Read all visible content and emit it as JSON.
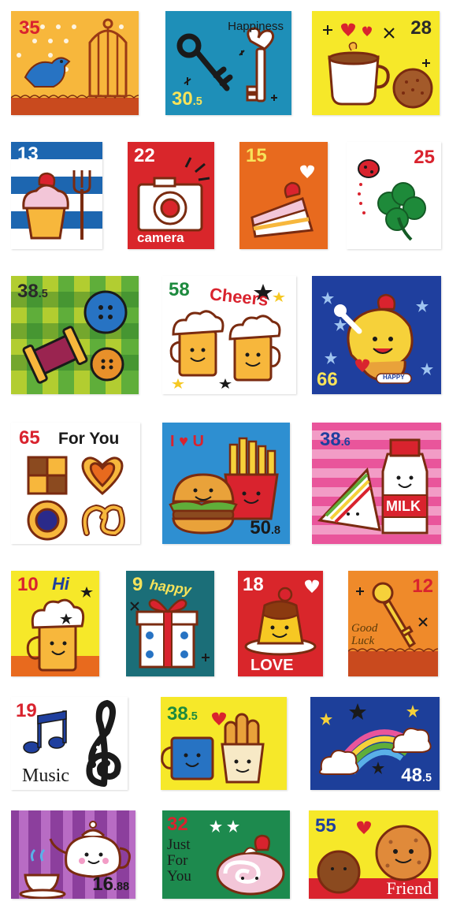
{
  "stickers": [
    {
      "id": "bird-cage",
      "value": "35",
      "bg": "#f7b73c",
      "num_color": "#d9232e"
    },
    {
      "id": "keys",
      "value": "30",
      "value_sub": ".5",
      "text": "Happiness",
      "bg": "#1e8fb8",
      "num_color": "#f7e35a"
    },
    {
      "id": "coffee-cookie",
      "value": "28",
      "bg": "#f6e829",
      "num_color": "#2a2a2a"
    },
    {
      "id": "cupcake",
      "value": "13",
      "bg": "#1d66b0",
      "num_color": "#ffffff"
    },
    {
      "id": "camera",
      "value": "22",
      "text": "camera",
      "bg": "#d9262b",
      "num_color": "#ffffff"
    },
    {
      "id": "cake",
      "value": "15",
      "bg": "#e86a1e",
      "num_color": "#f7e35a"
    },
    {
      "id": "clover",
      "value": "25",
      "bg": "#ffffff",
      "num_color": "#d9232e"
    },
    {
      "id": "spool-buttons",
      "value": "38",
      "value_sub": ".5",
      "bg": "#5fae3a",
      "num_color": "#2a2a2a"
    },
    {
      "id": "cheers",
      "value": "58",
      "text": "Cheers",
      "bg": "#ffffff",
      "num_color": "#1d8a3e"
    },
    {
      "id": "ice-cream",
      "value": "66",
      "text": "HAPPY",
      "bg": "#1f3f9e",
      "num_color": "#f7e35a"
    },
    {
      "id": "for-you-cookies",
      "value": "65",
      "text": "For You",
      "bg": "#ffffff",
      "num_color": "#d9232e"
    },
    {
      "id": "burger-fries",
      "value": "50",
      "value_sub": ".8",
      "text": "I ♥ U",
      "bg": "#2e8fd1",
      "num_color": "#1a1a1a"
    },
    {
      "id": "sandwich-milk",
      "value": "38",
      "value_sub": ".6",
      "text": "MILK",
      "bg": "#e9559b",
      "num_color": "#1f3f9e"
    },
    {
      "id": "hi-beer",
      "value": "10",
      "text": "Hi",
      "bg": "#f6e829",
      "num_color": "#d9232e"
    },
    {
      "id": "happy-gift",
      "value": "9",
      "text": "happy",
      "bg": "#1b6e78",
      "num_color": "#f7e35a"
    },
    {
      "id": "pudding",
      "value": "18",
      "text": "LOVE",
      "bg": "#d9262b",
      "num_color": "#ffffff"
    },
    {
      "id": "good-luck-key",
      "value": "12",
      "text": "Good Luck",
      "bg": "#ef8a2a",
      "num_color": "#d9232e"
    },
    {
      "id": "music",
      "value": "19",
      "text": "Music",
      "bg": "#ffffff",
      "num_color": "#d9232e"
    },
    {
      "id": "mug-bread",
      "value": "38",
      "value_sub": ".5",
      "bg": "#f6e829",
      "num_color": "#1d8a3e"
    },
    {
      "id": "rainbow",
      "value": "48",
      "value_sub": ".5",
      "bg": "#1d3f9a",
      "num_color": "#ffffff"
    },
    {
      "id": "teapot",
      "value": "16",
      "value_sub": ".88",
      "bg": "#8c3f9d",
      "num_color": "#1a1a1a"
    },
    {
      "id": "just-for-you",
      "value": "32",
      "text": "Just For You",
      "bg": "#1d8a4e",
      "num_color": "#d9232e"
    },
    {
      "id": "friend-cookies",
      "value": "55",
      "text": "Friend",
      "bg": "#f6e829",
      "num_color": "#1f3f9e"
    }
  ]
}
